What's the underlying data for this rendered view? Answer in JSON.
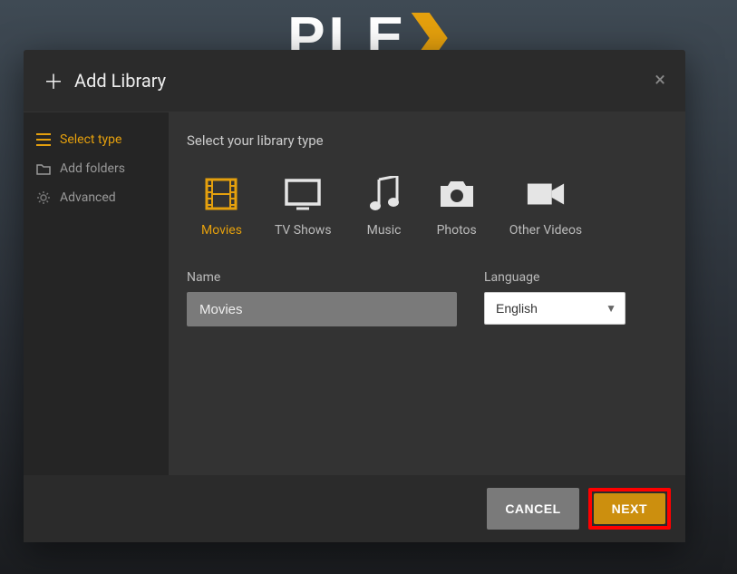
{
  "brand": {
    "name": "PLEX"
  },
  "modal": {
    "title": "Add Library",
    "closeGlyph": "×",
    "sidebar": {
      "items": [
        {
          "label": "Select type"
        },
        {
          "label": "Add folders"
        },
        {
          "label": "Advanced"
        }
      ]
    },
    "main": {
      "heading": "Select your library type",
      "types": [
        {
          "label": "Movies"
        },
        {
          "label": "TV Shows"
        },
        {
          "label": "Music"
        },
        {
          "label": "Photos"
        },
        {
          "label": "Other Videos"
        }
      ],
      "name_label": "Name",
      "name_value": "Movies",
      "lang_label": "Language",
      "lang_value": "English"
    },
    "footer": {
      "cancel": "CANCEL",
      "next": "NEXT"
    }
  },
  "colors": {
    "accent": "#e5a00d"
  }
}
